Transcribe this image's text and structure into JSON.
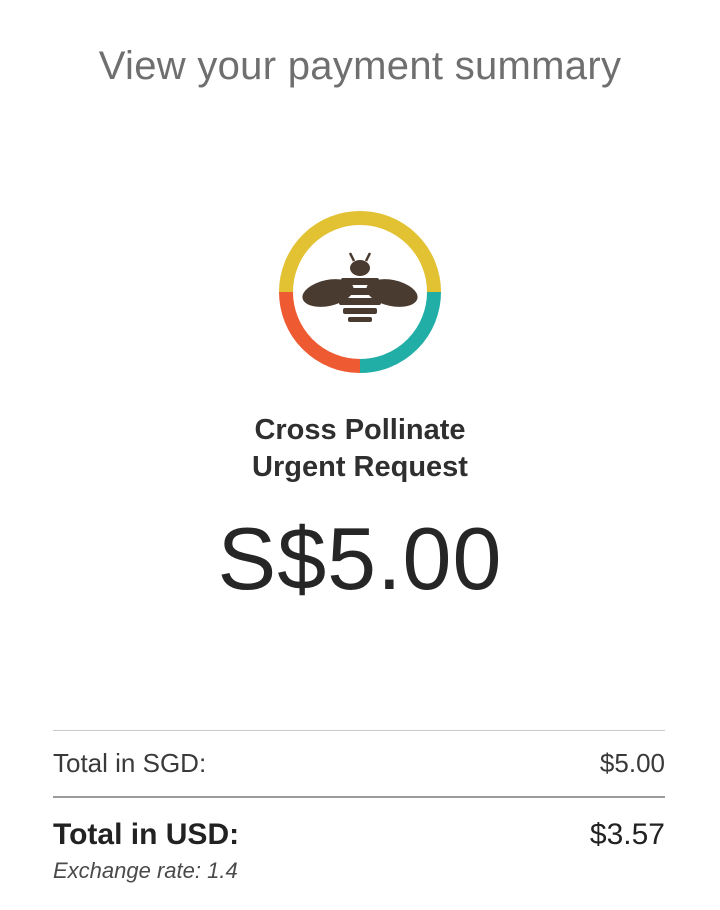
{
  "page": {
    "title": "View your payment summary"
  },
  "merchant": {
    "name_line1": "Cross Pollinate",
    "name_line2": "Urgent Request"
  },
  "payment": {
    "amount": "S$5.00"
  },
  "summary": {
    "sgd_label": "Total in SGD:",
    "sgd_value": "$5.00",
    "usd_label": "Total in USD:",
    "usd_value": "$3.57",
    "exchange_rate": "Exchange rate: 1.4"
  },
  "colors": {
    "ring_yellow": "#e2c233",
    "ring_teal": "#21aea6",
    "ring_orange": "#ee5a32",
    "bee_brown": "#4a3b30"
  },
  "icons": {
    "logo": "bee-logo-icon"
  }
}
